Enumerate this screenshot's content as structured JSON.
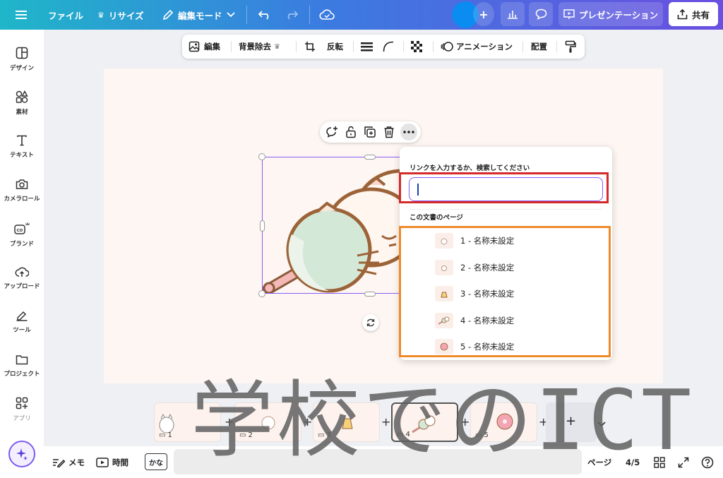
{
  "topbar": {
    "file": "ファイル",
    "resize": "リサイズ",
    "edit_mode": "編集モード",
    "present": "プレゼンテーション",
    "share": "共有"
  },
  "sidebar": {
    "items": [
      {
        "label": "デザイン",
        "icon": "layout-icon"
      },
      {
        "label": "素材",
        "icon": "shapes-icon"
      },
      {
        "label": "テキスト",
        "icon": "text-icon"
      },
      {
        "label": "カメラロール",
        "icon": "camera-icon"
      },
      {
        "label": "ブランド",
        "icon": "brand-icon"
      },
      {
        "label": "アップロード",
        "icon": "upload-icon"
      },
      {
        "label": "ツール",
        "icon": "pen-icon"
      },
      {
        "label": "プロジェクト",
        "icon": "folder-icon"
      },
      {
        "label": "アプリ",
        "icon": "apps-icon"
      }
    ]
  },
  "context_toolbar": {
    "edit": "編集",
    "bg_remove": "背景除去",
    "flip": "反転",
    "animation": "アニメーション",
    "arrange": "配置"
  },
  "link_popup": {
    "title": "リンクを入力するか、検索してください",
    "input_value": "",
    "section": "この文書のページ",
    "pages": [
      "1 - 名称未設定",
      "2 - 名称未設定",
      "3 - 名称未設定",
      "4 - 名称未設定",
      "5 - 名称未設定"
    ]
  },
  "page_strip": {
    "pages": [
      "1",
      "2",
      "3",
      "4",
      "5"
    ],
    "active": 4
  },
  "watermark": "学校でのICT",
  "bottombar": {
    "notes": "メモ",
    "timer": "時間",
    "kana": "かな",
    "page_label": "ページ",
    "page_count": "4/5"
  },
  "colors": {
    "accent": "#8b5cf6",
    "red_highlight": "#d42a2a",
    "orange_highlight": "#ef8a2b"
  }
}
